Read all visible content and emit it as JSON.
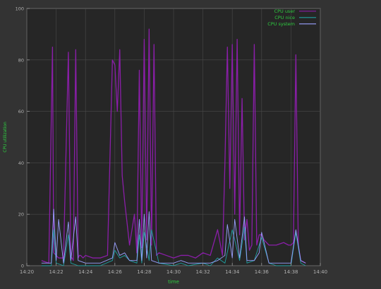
{
  "colors": {
    "background": "#333333",
    "plot_background": "#262626",
    "grid": "#4a4a4a",
    "frame": "#9a9a9a",
    "tick_text": "#b0b0b0",
    "label_text": "#2ecc40",
    "cpu_user": "#8a1ea8",
    "cpu_nice": "#1fa0a0",
    "cpu_system": "#9aa0ff"
  },
  "chart_data": {
    "type": "line",
    "title": "",
    "xlabel": "time",
    "ylabel": "CPU utilization",
    "xlim": [
      "14:20",
      "14:40"
    ],
    "ylim": [
      0,
      100
    ],
    "grid": true,
    "legend_position": "top-right",
    "x_ticks": [
      "14:20",
      "14:22",
      "14:24",
      "14:26",
      "14:28",
      "14:30",
      "14:32",
      "14:34",
      "14:36",
      "14:38",
      "14:40"
    ],
    "y_ticks": [
      "0",
      "20",
      "40",
      "60",
      "80",
      "100"
    ],
    "series": [
      {
        "name": "CPU user",
        "color": "#8a1ea8",
        "x": [
          "14:21:00",
          "14:21:30",
          "14:21:45",
          "14:21:50",
          "14:22:00",
          "14:22:10",
          "14:22:20",
          "14:22:30",
          "14:22:50",
          "14:23:00",
          "14:23:05",
          "14:23:10",
          "14:23:20",
          "14:23:30",
          "14:23:35",
          "14:23:40",
          "14:23:50",
          "14:24:00",
          "14:24:30",
          "14:25:00",
          "14:25:30",
          "14:25:50",
          "14:26:00",
          "14:26:10",
          "14:26:20",
          "14:26:30",
          "14:26:40",
          "14:27:00",
          "14:27:20",
          "14:27:30",
          "14:27:40",
          "14:27:50",
          "14:28:00",
          "14:28:10",
          "14:28:20",
          "14:28:30",
          "14:28:40",
          "14:28:50",
          "14:29:00",
          "14:29:30",
          "14:30:00",
          "14:30:30",
          "14:31:00",
          "14:31:30",
          "14:32:00",
          "14:32:30",
          "14:33:00",
          "14:33:20",
          "14:33:30",
          "14:33:40",
          "14:33:50",
          "14:34:00",
          "14:34:10",
          "14:34:20",
          "14:34:30",
          "14:34:40",
          "14:34:50",
          "14:35:00",
          "14:35:10",
          "14:35:20",
          "14:35:30",
          "14:35:40",
          "14:35:50",
          "14:36:00",
          "14:36:10",
          "14:36:20",
          "14:36:30",
          "14:36:40",
          "14:37:00",
          "14:37:30",
          "14:37:50",
          "14:38:00",
          "14:38:10",
          "14:38:20",
          "14:38:30",
          "14:38:40",
          "14:39:00"
        ],
        "values": [
          2,
          1,
          85,
          5,
          4,
          3,
          3,
          3,
          83,
          3,
          3,
          2,
          84,
          3,
          4,
          4,
          3,
          4,
          3,
          3,
          4,
          80,
          78,
          60,
          84,
          35,
          25,
          8,
          20,
          5,
          76,
          7,
          88,
          10,
          92,
          8,
          86,
          4,
          5,
          4,
          3,
          4,
          4,
          3,
          5,
          4,
          14,
          4,
          40,
          85,
          30,
          86,
          20,
          88,
          12,
          65,
          10,
          18,
          6,
          8,
          86,
          8,
          12,
          12,
          10,
          9,
          8,
          8,
          8,
          9,
          8,
          8,
          9,
          82,
          8,
          2,
          1
        ]
      },
      {
        "name": "CPU nice",
        "color": "#1fa0a0",
        "x": [
          "14:21:00",
          "14:21:40",
          "14:21:50",
          "14:22:00",
          "14:22:30",
          "14:22:50",
          "14:23:00",
          "14:23:30",
          "14:24:00",
          "14:25:00",
          "14:25:50",
          "14:26:00",
          "14:26:20",
          "14:26:40",
          "14:27:00",
          "14:27:30",
          "14:27:40",
          "14:27:50",
          "14:28:00",
          "14:28:20",
          "14:28:30",
          "14:29:00",
          "14:30:00",
          "14:30:30",
          "14:31:00",
          "14:32:00",
          "14:32:30",
          "14:33:00",
          "14:33:30",
          "14:34:00",
          "14:34:30",
          "14:34:50",
          "14:35:00",
          "14:35:30",
          "14:36:00",
          "14:36:30",
          "14:37:00",
          "14:38:00",
          "14:38:20",
          "14:38:40",
          "14:39:00"
        ],
        "values": [
          0,
          0,
          14,
          1,
          0,
          12,
          1,
          0,
          0,
          0,
          2,
          6,
          3,
          4,
          2,
          1,
          12,
          1,
          13,
          2,
          14,
          1,
          0,
          1,
          0,
          1,
          0,
          3,
          1,
          14,
          2,
          15,
          1,
          2,
          11,
          1,
          0,
          0,
          13,
          1,
          0
        ]
      },
      {
        "name": "CPU system",
        "color": "#9aa0ff",
        "x": [
          "14:21:00",
          "14:21:40",
          "14:21:50",
          "14:22:00",
          "14:22:10",
          "14:22:30",
          "14:22:50",
          "14:23:00",
          "14:23:20",
          "14:23:30",
          "14:24:00",
          "14:25:00",
          "14:25:50",
          "14:26:00",
          "14:26:20",
          "14:26:40",
          "14:27:00",
          "14:27:30",
          "14:27:40",
          "14:27:50",
          "14:28:00",
          "14:28:10",
          "14:28:20",
          "14:28:30",
          "14:29:00",
          "14:30:00",
          "14:30:30",
          "14:31:00",
          "14:32:00",
          "14:32:30",
          "14:33:00",
          "14:33:30",
          "14:33:40",
          "14:34:00",
          "14:34:10",
          "14:34:30",
          "14:34:50",
          "14:35:00",
          "14:35:30",
          "14:35:50",
          "14:36:00",
          "14:36:30",
          "14:37:00",
          "14:38:00",
          "14:38:20",
          "14:38:40",
          "14:39:00"
        ],
        "values": [
          1,
          1,
          22,
          2,
          18,
          1,
          17,
          2,
          19,
          2,
          1,
          1,
          3,
          9,
          4,
          5,
          2,
          2,
          18,
          2,
          20,
          3,
          21,
          2,
          1,
          1,
          2,
          1,
          1,
          1,
          2,
          4,
          16,
          3,
          18,
          3,
          19,
          2,
          2,
          5,
          13,
          1,
          1,
          1,
          14,
          2,
          1
        ]
      }
    ]
  }
}
